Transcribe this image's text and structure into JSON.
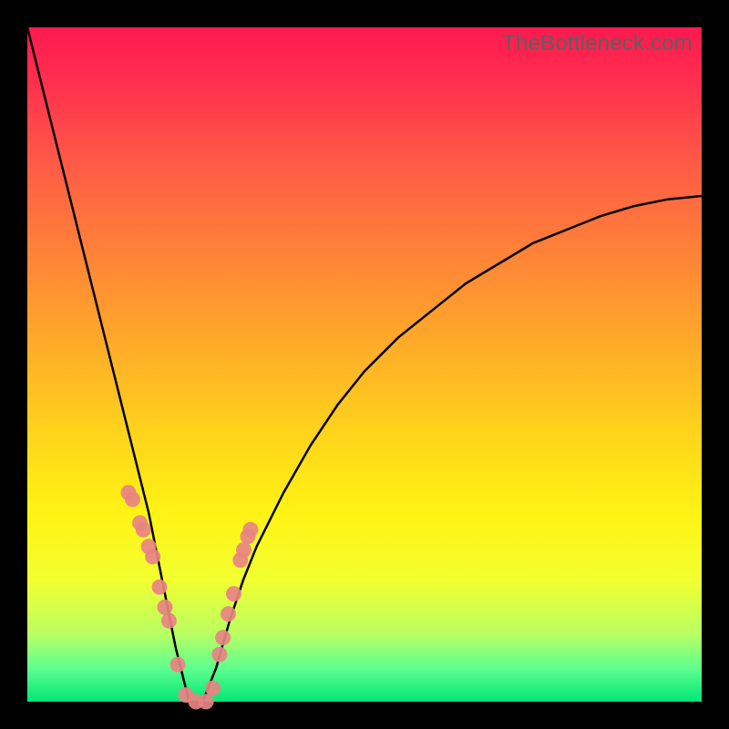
{
  "watermark": "TheBottleneck.com",
  "colors": {
    "background": "#000000",
    "gradient_top": "#ff1950",
    "gradient_bottom": "#00e676",
    "curve": "#000000",
    "dots": "#e88383"
  },
  "chart_data": {
    "type": "line",
    "title": "",
    "xlabel": "",
    "ylabel": "",
    "xlim": [
      0,
      100
    ],
    "ylim": [
      0,
      100
    ],
    "grid": false,
    "legend": false,
    "description": "Bottleneck percentage curve with a sharp valley near x≈24 reaching ≈0%, rising steeply toward 100% at the left edge and gradually toward ≈75% at the right edge.",
    "series": [
      {
        "name": "bottleneck-curve",
        "x": [
          0,
          2,
          4,
          6,
          8,
          10,
          12,
          14,
          16,
          18,
          20,
          22,
          24,
          26,
          28,
          30,
          32,
          34,
          38,
          42,
          46,
          50,
          55,
          60,
          65,
          70,
          75,
          80,
          85,
          90,
          95,
          100
        ],
        "values": [
          100,
          92,
          84,
          76,
          68,
          60,
          52,
          44,
          36,
          28,
          18,
          8,
          0,
          0,
          5,
          12,
          18,
          23,
          31,
          38,
          44,
          49,
          54,
          58,
          62,
          65,
          68,
          70,
          72,
          73.5,
          74.5,
          75
        ]
      }
    ],
    "dots": {
      "name": "highlighted-points",
      "x": [
        15.0,
        15.6,
        16.7,
        17.2,
        18.0,
        18.6,
        19.6,
        20.4,
        21.0,
        22.3,
        23.5,
        25.0,
        26.5,
        27.5,
        28.5,
        29.0,
        29.8,
        30.6,
        31.6,
        32.1,
        32.7,
        33.1
      ],
      "values": [
        31.0,
        30.0,
        26.5,
        25.5,
        23.0,
        21.5,
        17.0,
        14.0,
        12.0,
        5.5,
        1.0,
        0.0,
        0.0,
        2.0,
        7.0,
        9.5,
        13.0,
        16.0,
        21.0,
        22.5,
        24.5,
        25.5
      ]
    }
  }
}
